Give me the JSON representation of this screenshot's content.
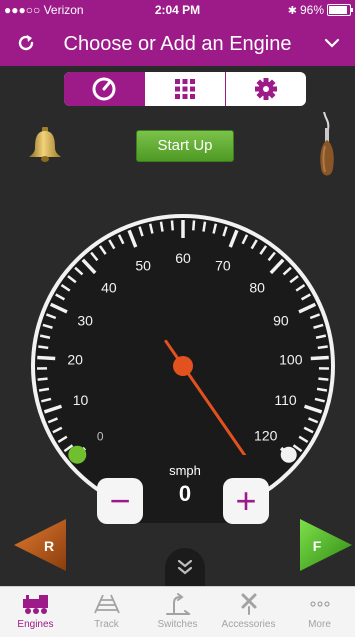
{
  "status_bar": {
    "carrier": "●●●○○ Verizon",
    "time": "2:04 PM",
    "battery": "96%"
  },
  "nav": {
    "title": "Choose or Add an Engine"
  },
  "mode_tabs": [
    {
      "name": "speedometer",
      "active": true
    },
    {
      "name": "keypad",
      "active": false
    },
    {
      "name": "settings",
      "active": false
    }
  ],
  "controls": {
    "start_up_label": "Start Up"
  },
  "gauge": {
    "tick_labels": [
      "0",
      "10",
      "20",
      "30",
      "40",
      "50",
      "60",
      "70",
      "80",
      "90",
      "100",
      "110",
      "120"
    ],
    "max_speed": 120,
    "throttle_marker": 0,
    "needle_value": 44,
    "unit": "smph",
    "speed": "0"
  },
  "buttons": {
    "minus": "−",
    "plus": "+",
    "reverse": "R",
    "forward": "F"
  },
  "tabs": [
    {
      "label": "Engines",
      "active": true
    },
    {
      "label": "Track",
      "active": false
    },
    {
      "label": "Switches",
      "active": false
    },
    {
      "label": "Accessories",
      "active": false
    },
    {
      "label": "More",
      "active": false
    }
  ],
  "colors": {
    "accent": "#9c1b89",
    "needle": "#e2521f",
    "startup": "#5fae31",
    "reverse": "#c25c1d",
    "forward": "#4db82a"
  }
}
